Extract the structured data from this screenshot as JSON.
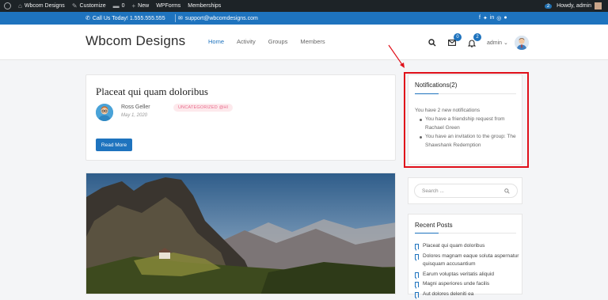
{
  "admin_bar": {
    "site_name": "Wbcom Designs",
    "customize": "Customize",
    "comments_count": "0",
    "new_label": "New",
    "wpforms": "WPForms",
    "memberships": "Memberships",
    "notif_count": "2",
    "howdy": "Howdy, admin"
  },
  "top_bar": {
    "phone": "Call Us Today! 1.555.555.555",
    "email": "support@wbcomdesigns.com"
  },
  "header": {
    "brand": "Wbcom Designs",
    "nav": [
      "Home",
      "Activity",
      "Groups",
      "Members"
    ],
    "messages_badge": "0",
    "notifications_badge": "2",
    "user": "admin"
  },
  "post": {
    "title": "Placeat qui quam doloribus",
    "author": "Ross Geller",
    "date": "May 1, 2020",
    "category": "UNCATEGORIZED @HI",
    "read_more": "Read More"
  },
  "notifications_widget": {
    "title": "Notifications(2)",
    "summary": "You have 2 new notifications",
    "items": [
      "You have a friendship request from Rachael Green",
      "You have an invitation to the group: The Shawshank Redemption"
    ]
  },
  "search_widget": {
    "placeholder": "Search ..."
  },
  "recent_posts": {
    "title": "Recent Posts",
    "items": [
      "Placeat qui quam doloribus",
      "Dolores magnam eaque soluta aspernatur quisquam accusantium",
      "Earum voluptas veritatis aliquid",
      "Magni asperiores unde facilis",
      "Aut dolores deleniti ea"
    ]
  },
  "colors": {
    "accent": "#1e73be",
    "admin_bar": "#1d2327",
    "highlight": "#e0101a",
    "category_badge": "#e8698a"
  }
}
